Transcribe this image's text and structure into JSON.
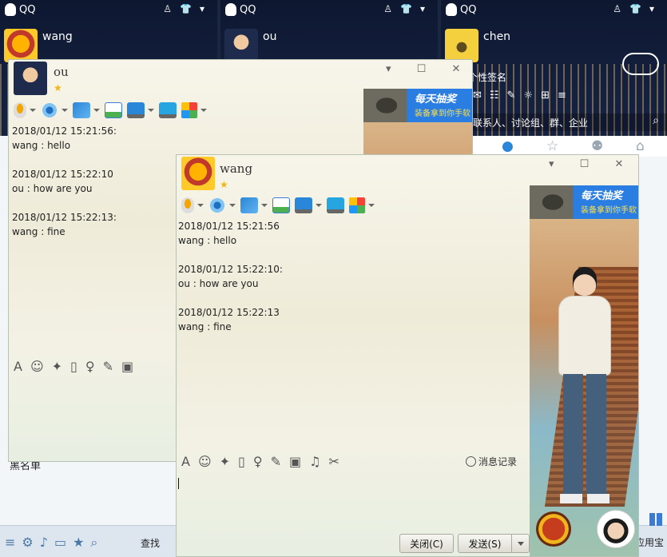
{
  "panels": {
    "wang": {
      "app_title": "QQ",
      "nickname": "wang",
      "blacklist_label": "黑名单",
      "find_label": "查找"
    },
    "ou": {
      "app_title": "QQ",
      "nickname": "ou"
    },
    "chen": {
      "app_title": "QQ",
      "nickname": "chen",
      "signature": "个性签名",
      "contact_hint": "联系人、讨论组、群、企业",
      "app_label": "应用宝"
    }
  },
  "chat_ou": {
    "contact_name": "ou",
    "window_controls": [
      "▾",
      "☐",
      "✕"
    ],
    "messages": [
      {
        "time": "2018/01/12 15:21:56:",
        "text": "wang : hello"
      },
      {
        "time": "2018/01/12 15:22:10",
        "text": "ou : how are you"
      },
      {
        "time": "2018/01/12 15:22:13:",
        "text": "wang : fine"
      }
    ],
    "ad": {
      "title": "每天抽奖",
      "subtitle": "装备拿到你手软"
    }
  },
  "chat_wang": {
    "contact_name": "wang",
    "window_controls": [
      "▾",
      "☐",
      "✕"
    ],
    "messages": [
      {
        "time": "2018/01/12 15:21:56",
        "text": "wang : hello"
      },
      {
        "time": "2018/01/12 15:22:10:",
        "text": "ou : how are you"
      },
      {
        "time": "2018/01/12 15:22:13",
        "text": "wang : fine"
      }
    ],
    "ad": {
      "title": "每天抽奖",
      "subtitle": "装备拿到你手软"
    },
    "history_label": "消息记录",
    "close_button": "关闭(C)",
    "send_button": "发送(S)"
  },
  "icons": {
    "toolbar": [
      "mic-icon",
      "camera-icon",
      "file-transfer-icon",
      "remote-assist-icon",
      "screen-share-icon",
      "share-icon",
      "more-apps-icon"
    ],
    "input": [
      "font-icon",
      "emoji-icon",
      "magic-icon",
      "shake-icon",
      "voice-icon",
      "edit-icon",
      "image-icon",
      "music-icon",
      "scissors-icon"
    ]
  }
}
